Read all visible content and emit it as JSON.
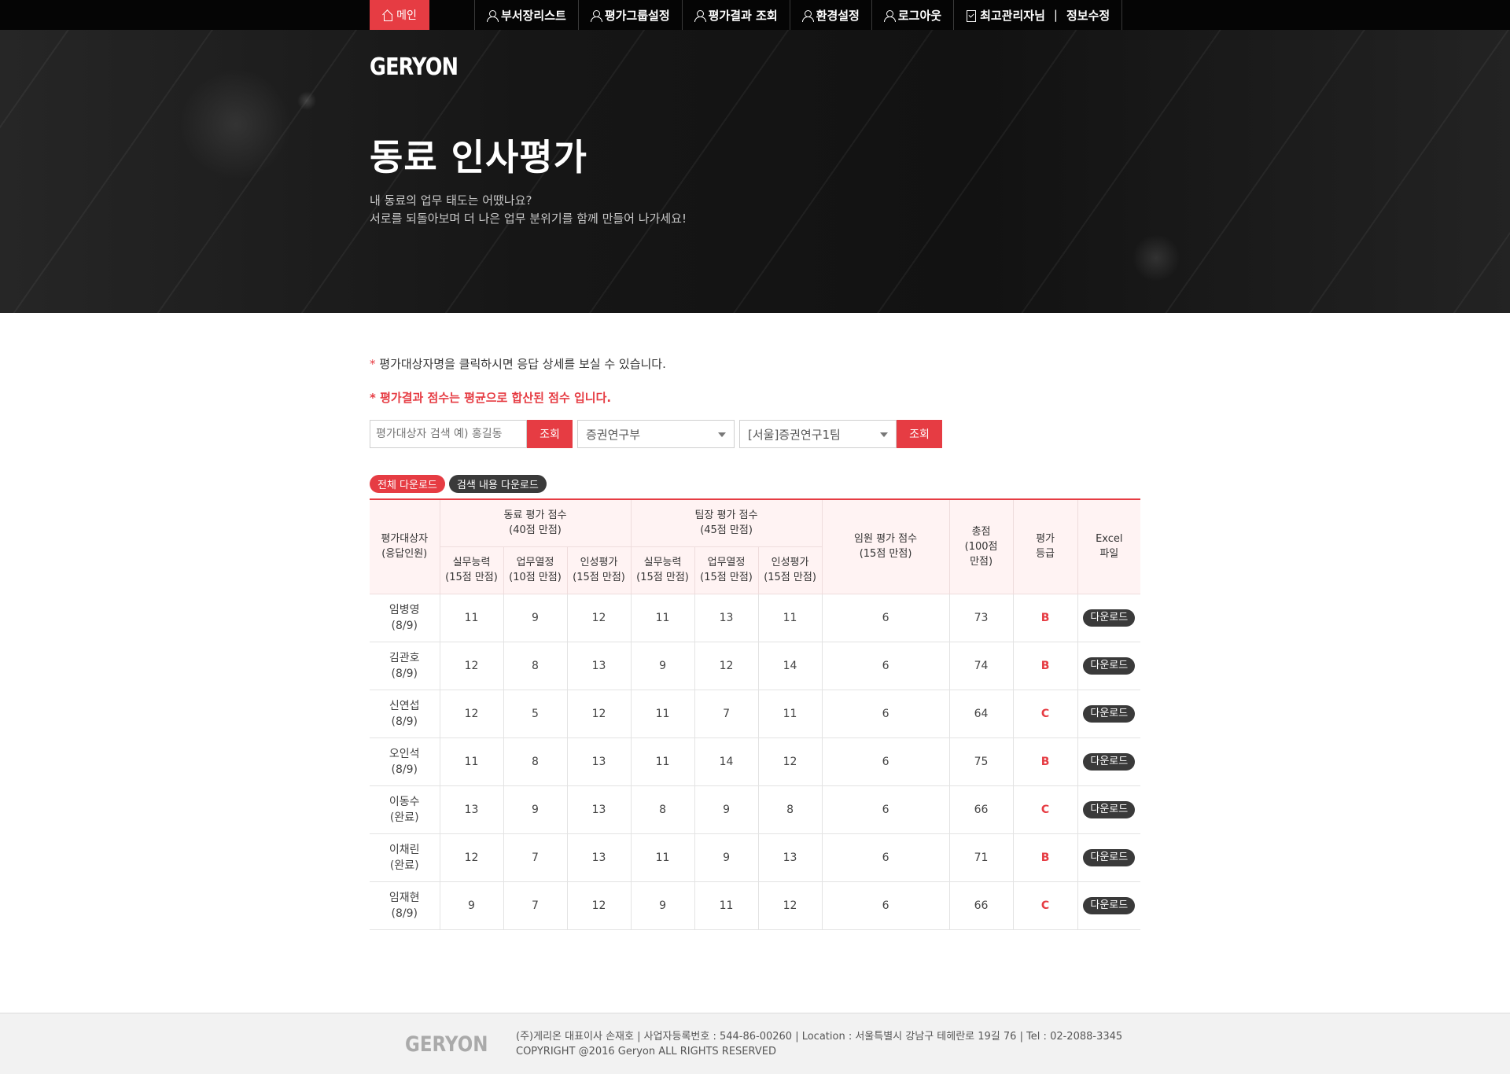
{
  "nav": {
    "home": "메인",
    "items": [
      {
        "label": "부서장리스트",
        "icon": "user-icon"
      },
      {
        "label": "평가그룹설정",
        "icon": "user-icon"
      },
      {
        "label": "평가결과 조회",
        "icon": "user-icon"
      },
      {
        "label": "환경설정",
        "icon": "user-icon"
      },
      {
        "label": "로그아웃",
        "icon": "user-icon"
      }
    ],
    "admin_name": "최고관리자님",
    "separator": "|",
    "edit_info": "정보수정"
  },
  "hero": {
    "logo": "GERYON",
    "title": "동료 인사평가",
    "subtitle_line1": "내 동료의 업무 태도는 어땠나요?",
    "subtitle_line2": "서로를 되돌아보며 더 나은 업무 분위기를 함께 만들어 나가세요!"
  },
  "notes": {
    "star": "*",
    "note1": "평가대상자명을 클릭하시면 응답 상세를 보실 수 있습니다.",
    "note2": "평가결과 점수는 평균으로 합산된 점수 입니다."
  },
  "search": {
    "placeholder": "평가대상자 검색 예) 홍길동",
    "button1": "조회",
    "select_dept": "증권연구부",
    "select_team": "[서울]증권연구1팀",
    "button2": "조회"
  },
  "downloads": {
    "all": "전체 다운로드",
    "search_result": "검색 내용 다운로드"
  },
  "table": {
    "headers": {
      "target": "평가대상자",
      "target_sub": "(응답인원)",
      "peer": "동료 평가 점수",
      "peer_sub": "(40점 만점)",
      "leader": "팀장 평가 점수",
      "leader_sub": "(45점 만점)",
      "exec": "임원 평가 점수",
      "exec_sub": "(15점 만점)",
      "total": "총점",
      "total_sub1": "(100점",
      "total_sub2": "만점)",
      "grade1": "평가",
      "grade2": "등급",
      "excel1": "Excel",
      "excel2": "파일",
      "sub": [
        {
          "name": "실무능력",
          "max": "(15점 만점)"
        },
        {
          "name": "업무열정",
          "max": "(10점 만점)"
        },
        {
          "name": "인성평가",
          "max": "(15점 만점)"
        },
        {
          "name": "실무능력",
          "max": "(15점 만점)"
        },
        {
          "name": "업무열정",
          "max": "(15점 만점)"
        },
        {
          "name": "인성평가",
          "max": "(15점 만점)"
        }
      ]
    },
    "download_label": "다운로드",
    "rows": [
      {
        "name": "임병영",
        "resp": "(8/9)",
        "scores": [
          "11",
          "9",
          "12",
          "11",
          "13",
          "11"
        ],
        "exec": "6",
        "total": "73",
        "grade": "B"
      },
      {
        "name": "김관호",
        "resp": "(8/9)",
        "scores": [
          "12",
          "8",
          "13",
          "9",
          "12",
          "14"
        ],
        "exec": "6",
        "total": "74",
        "grade": "B"
      },
      {
        "name": "신연섭",
        "resp": "(8/9)",
        "scores": [
          "12",
          "5",
          "12",
          "11",
          "7",
          "11"
        ],
        "exec": "6",
        "total": "64",
        "grade": "C"
      },
      {
        "name": "오인석",
        "resp": "(8/9)",
        "scores": [
          "11",
          "8",
          "13",
          "11",
          "14",
          "12"
        ],
        "exec": "6",
        "total": "75",
        "grade": "B"
      },
      {
        "name": "이동수",
        "resp": "(완료)",
        "scores": [
          "13",
          "9",
          "13",
          "8",
          "9",
          "8"
        ],
        "exec": "6",
        "total": "66",
        "grade": "C"
      },
      {
        "name": "이채린",
        "resp": "(완료)",
        "scores": [
          "12",
          "7",
          "13",
          "11",
          "9",
          "13"
        ],
        "exec": "6",
        "total": "71",
        "grade": "B"
      },
      {
        "name": "임재현",
        "resp": "(8/9)",
        "scores": [
          "9",
          "7",
          "12",
          "9",
          "11",
          "12"
        ],
        "exec": "6",
        "total": "66",
        "grade": "C"
      }
    ]
  },
  "footer": {
    "logo": "GERYON",
    "line1": "(주)게리온 대표이사 손재호 | 사업자등록번호 : 544-86-00260 | Location : 서울특별시 강남구 테헤란로 19길 76 | Tel : 02-2088-3345",
    "line2": "COPYRIGHT @2016 Geryon ALL RIGHTS RESERVED"
  },
  "colors": {
    "accent": "#e63c43",
    "dark": "#3a3a3a",
    "header_bg": "#fff3f3"
  }
}
